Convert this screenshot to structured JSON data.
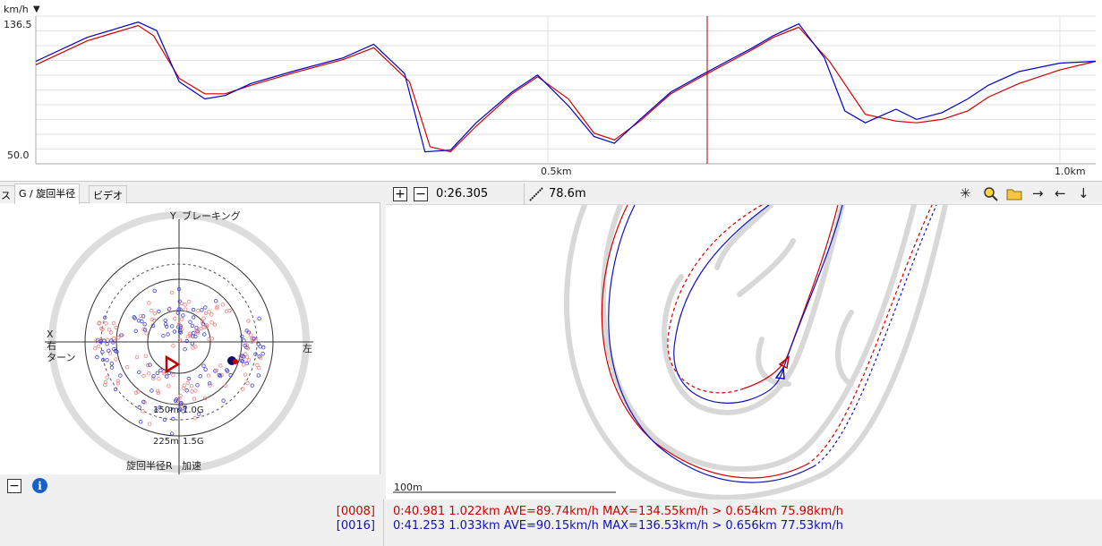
{
  "speed_chart": {
    "unit_label": "km/h",
    "unit_arrow": "▼",
    "y_max_label": "136.5",
    "y_min_label": "50.0",
    "x_tick_labels": [
      "0.5km",
      "1.0km"
    ],
    "chart_data": {
      "type": "line",
      "ylim": [
        50.0,
        136.5
      ],
      "xlim": [
        0.0,
        1.035
      ],
      "series_colors": [
        "#d00000",
        "#0000c8"
      ],
      "series": [
        {
          "x": [
            0,
            0.05,
            0.1,
            0.115,
            0.14,
            0.165,
            0.185,
            0.21,
            0.25,
            0.3,
            0.33,
            0.365,
            0.385,
            0.405,
            0.43,
            0.465,
            0.49,
            0.52,
            0.545,
            0.565,
            0.59,
            0.62,
            0.65,
            0.675,
            0.7,
            0.72,
            0.745,
            0.775,
            0.81,
            0.84,
            0.86,
            0.885,
            0.91,
            0.93,
            0.96,
            1.0,
            1.035
          ],
          "y": [
            108,
            122,
            131,
            125,
            100,
            91,
            91,
            96,
            103,
            111,
            118,
            98,
            60,
            57,
            72,
            91,
            101,
            88,
            68,
            64,
            75,
            91,
            101,
            109,
            117,
            124,
            130,
            110,
            79,
            75,
            74,
            76,
            81,
            89,
            97,
            105,
            110
          ]
        },
        {
          "x": [
            0,
            0.05,
            0.1,
            0.118,
            0.14,
            0.165,
            0.185,
            0.21,
            0.25,
            0.3,
            0.33,
            0.36,
            0.38,
            0.405,
            0.43,
            0.465,
            0.49,
            0.52,
            0.545,
            0.565,
            0.59,
            0.62,
            0.65,
            0.675,
            0.7,
            0.72,
            0.745,
            0.77,
            0.79,
            0.81,
            0.84,
            0.86,
            0.885,
            0.91,
            0.93,
            0.96,
            1.0,
            1.035
          ],
          "y": [
            110,
            124,
            133,
            128,
            98,
            88,
            90,
            97,
            104,
            112,
            120,
            103,
            57,
            58,
            74,
            92,
            102,
            84,
            66,
            62,
            76,
            92,
            102,
            110,
            118,
            125,
            132,
            112,
            81,
            74,
            82,
            76,
            80,
            88,
            96,
            104,
            109,
            110
          ]
        }
      ]
    }
  },
  "left_panel": {
    "tabs": [
      "ス",
      "G / 旋回半径",
      "ビデオ"
    ],
    "gg_labels": {
      "y_axis": "Y",
      "top": "ブレーキング",
      "x_axis": "X",
      "right_turn": "右\nターン",
      "left": "左",
      "ring1": "150m",
      "ring1_g": "1.0G",
      "ring2": "225m",
      "ring2_g": "1.5G",
      "bottom_left": "旋回半径R",
      "bottom_right": "加速"
    }
  },
  "map_panel": {
    "lap_time": "0:26.305",
    "distance": "78.6m",
    "scale_label": "100m",
    "toolbar_icons": [
      "burst-icon",
      "zoom-icon",
      "folder-icon",
      "arrow-right-icon",
      "arrow-left-icon",
      "arrow-down-icon"
    ]
  },
  "footer": {
    "lap1": {
      "id": "[0008]",
      "summary": "0:40.981 1.022km AVE=89.74km/h MAX=134.55km/h > 0.654km 75.98km/h",
      "color": "#d00000"
    },
    "lap2": {
      "id": "[0016]",
      "summary": "0:41.253 1.033km AVE=90.15km/h MAX=136.53km/h > 0.656km 77.53km/h",
      "color": "#1010c0"
    }
  }
}
